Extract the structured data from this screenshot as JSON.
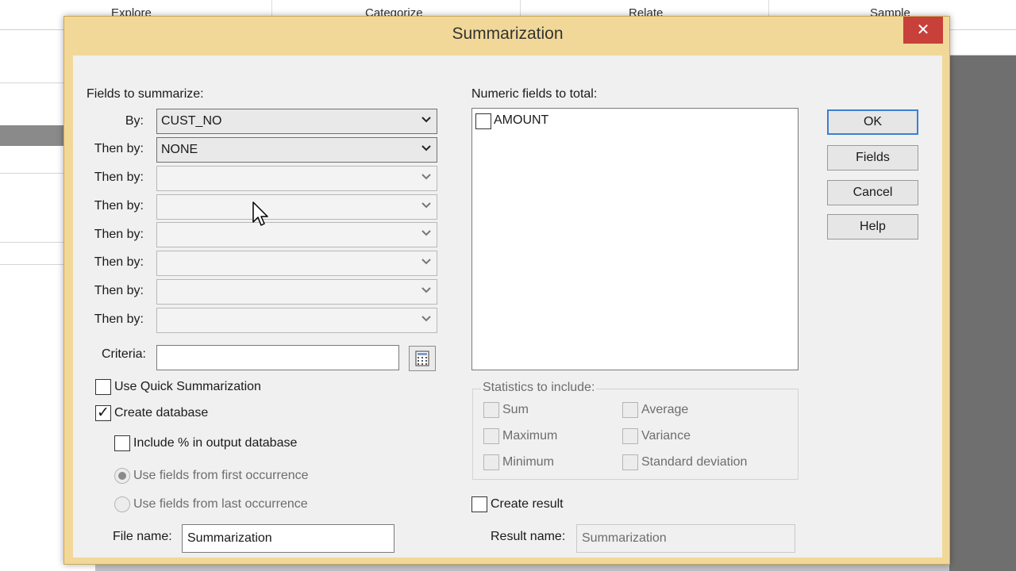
{
  "background": {
    "header_items": [
      "Explore",
      "Categorize",
      "Relate",
      "Sample"
    ]
  },
  "dialog": {
    "title": "Summarization",
    "close_glyph": "✕",
    "fields_to_summarize_label": "Fields to summarize:",
    "by_label": "By:",
    "then_by_label": "Then by:",
    "by_value": "CUST_NO",
    "then_by_values": [
      "NONE",
      "",
      "",
      "",
      "",
      "",
      ""
    ],
    "criteria_label": "Criteria:",
    "criteria_value": "",
    "numeric_fields_label": "Numeric fields to total:",
    "numeric_fields": [
      {
        "name": "AMOUNT",
        "checked": false
      }
    ],
    "statistics_label": "Statistics to include:",
    "statistics": {
      "sum": "Sum",
      "maximum": "Maximum",
      "minimum": "Minimum",
      "average": "Average",
      "variance": "Variance",
      "std_dev": "Standard deviation"
    },
    "use_quick_summarization": {
      "label": "Use Quick Summarization",
      "checked": false
    },
    "create_database": {
      "label": "Create database",
      "checked": true,
      "mark": "✓"
    },
    "include_percent": {
      "label": "Include % in output database",
      "checked": false
    },
    "use_first": {
      "label": "Use fields from first occurrence",
      "selected": true
    },
    "use_last": {
      "label": "Use fields from last occurrence",
      "selected": false
    },
    "file_name_label": "File name:",
    "file_name_value": "Summarization",
    "create_result": {
      "label": "Create result",
      "checked": false
    },
    "result_name_label": "Result name:",
    "result_name_value": "Summarization",
    "buttons": {
      "ok": "OK",
      "fields": "Fields",
      "cancel": "Cancel",
      "help": "Help"
    }
  }
}
